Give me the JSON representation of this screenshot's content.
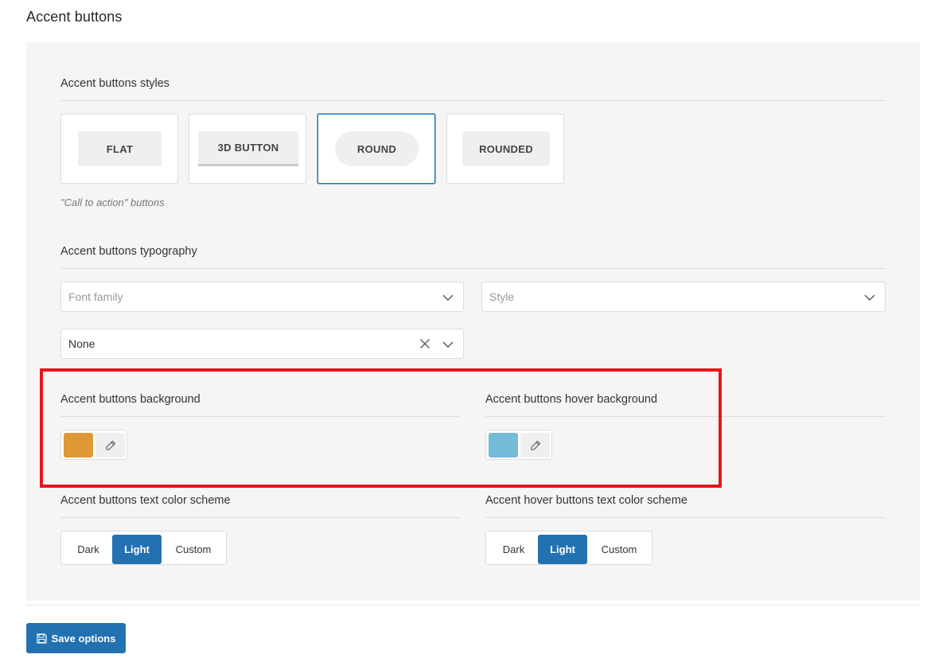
{
  "page": {
    "title": "Accent buttons"
  },
  "styles_section": {
    "label": "Accent buttons styles",
    "options": [
      {
        "label": "FLAT",
        "shape": "flat",
        "selected": false
      },
      {
        "label": "3D BUTTON",
        "shape": "3d",
        "selected": false
      },
      {
        "label": "ROUND",
        "shape": "round",
        "selected": true
      },
      {
        "label": "ROUNDED",
        "shape": "rounded",
        "selected": false
      }
    ],
    "hint": "\"Call to action\" buttons"
  },
  "typography_section": {
    "label": "Accent buttons typography",
    "font_family": {
      "placeholder": "Font family",
      "value": ""
    },
    "style": {
      "placeholder": "Style",
      "value": ""
    },
    "transform": {
      "value": "None"
    }
  },
  "background": {
    "label": "Accent buttons background",
    "color": "#dd9933",
    "icon": "eyedropper-icon"
  },
  "hover_background": {
    "label": "Accent buttons hover background",
    "color": "#73bbd6",
    "icon": "eyedropper-icon"
  },
  "text_scheme": {
    "label": "Accent buttons text color scheme",
    "options": [
      "Dark",
      "Light",
      "Custom"
    ],
    "selected": "Light"
  },
  "hover_text_scheme": {
    "label": "Accent hover buttons text color scheme",
    "options": [
      "Dark",
      "Light",
      "Custom"
    ],
    "selected": "Light"
  },
  "save": {
    "label": "Save options",
    "icon": "floppy-disk-icon"
  },
  "colors": {
    "accent": "#2271b1",
    "highlight": "#e8141c"
  }
}
